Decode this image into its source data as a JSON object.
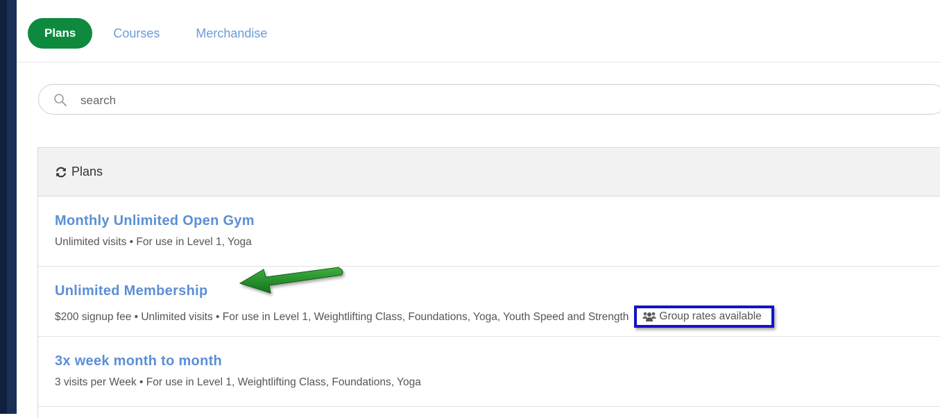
{
  "tabs": [
    {
      "label": "Plans",
      "active": true
    },
    {
      "label": "Courses",
      "active": false
    },
    {
      "label": "Merchandise",
      "active": false
    }
  ],
  "search": {
    "placeholder": "search"
  },
  "panel": {
    "header": "Plans"
  },
  "plans": [
    {
      "title": "Monthly Unlimited Open Gym",
      "description": "Unlimited visits • For use in Level 1, Yoga"
    },
    {
      "title": "Unlimited Membership",
      "description": "$200 signup fee • Unlimited visits • For use in Level 1, Weightlifting Class, Foundations, Yoga, Youth Speed and Strength",
      "badge": "Group rates available"
    },
    {
      "title": "3x week month to month",
      "description": "3 visits per Week • For use in Level 1, Weightlifting Class, Foundations, Yoga"
    }
  ],
  "colors": {
    "accent_green": "#0e8a3e",
    "link_blue": "#5b8fd4",
    "annotation_box": "#1212c8",
    "annotation_arrow": "#1f8a2a",
    "sidebar": "#10213f"
  },
  "icons": {
    "search": "search-icon",
    "refresh": "refresh-icon",
    "group": "group-icon",
    "annotation": "arrow-annotation-icon"
  }
}
